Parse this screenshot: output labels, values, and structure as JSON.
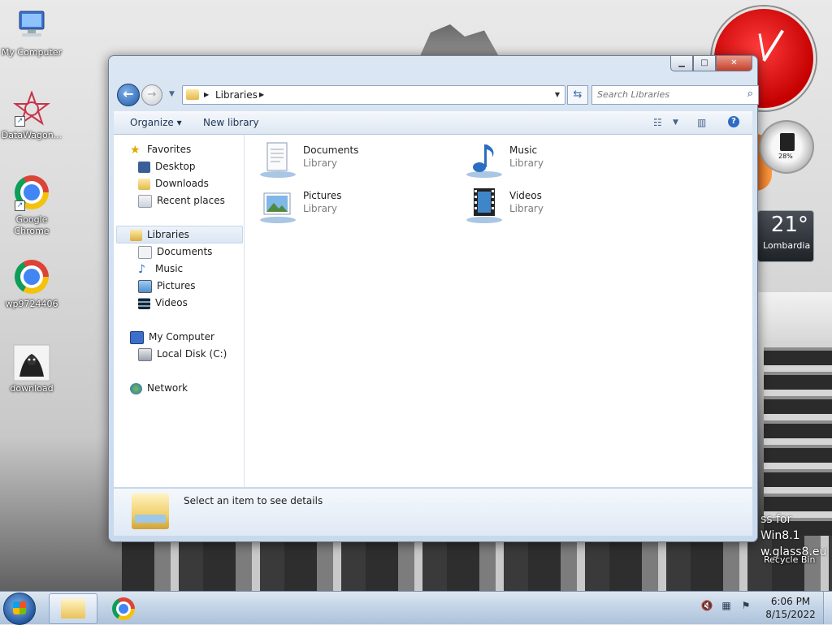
{
  "desktop": {
    "icons": [
      {
        "label": "My Computer"
      },
      {
        "label": "DataWagon..."
      },
      {
        "label": "Google Chrome"
      },
      {
        "label": "wp9724406"
      },
      {
        "label": "download"
      }
    ],
    "recycle_bin_label": "Recycle Bin",
    "watermark": [
      "ss for Win8.1",
      "w.glass8.eu"
    ]
  },
  "gadgets": {
    "cpu_percent": "28%",
    "weather_temp": "21°",
    "weather_location": "Lombardia"
  },
  "window": {
    "address": {
      "crumb": "Libraries"
    },
    "search": {
      "placeholder": "Search Libraries"
    },
    "toolbar": {
      "organize": "Organize ▾",
      "new_library": "New library"
    },
    "nav_pane": {
      "favorites": "Favorites",
      "favorites_items": [
        "Desktop",
        "Downloads",
        "Recent places"
      ],
      "libraries": "Libraries",
      "libraries_items": [
        "Documents",
        "Music",
        "Pictures",
        "Videos"
      ],
      "computer": "My Computer",
      "computer_items": [
        "Local Disk (C:)"
      ],
      "network": "Network"
    },
    "libraries": [
      {
        "name": "Documents",
        "type": "Library"
      },
      {
        "name": "Music",
        "type": "Library"
      },
      {
        "name": "Pictures",
        "type": "Library"
      },
      {
        "name": "Videos",
        "type": "Library"
      }
    ],
    "details_text": "Select an item to see details"
  },
  "taskbar": {
    "time": "6:06 PM",
    "date": "8/15/2022"
  }
}
